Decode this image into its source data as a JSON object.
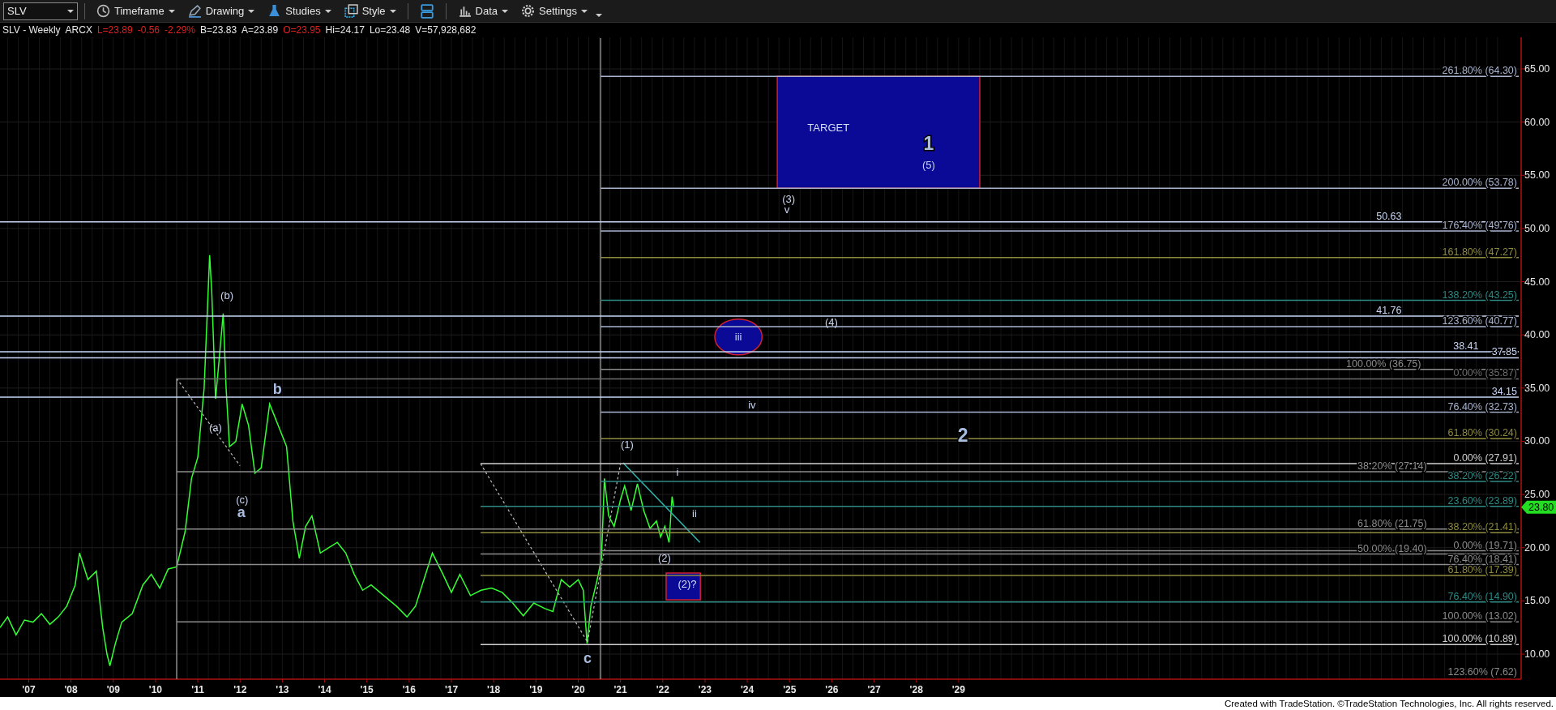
{
  "toolbar": {
    "symbol": "SLV",
    "groups": [
      [
        {
          "label": "Timeframe"
        },
        {
          "label": "Drawing"
        },
        {
          "label": "Studies"
        },
        {
          "label": "Style"
        }
      ],
      [
        {
          "label": "Data"
        },
        {
          "label": "Settings"
        }
      ]
    ]
  },
  "quote": [
    {
      "text": "SLV - Weekly",
      "color": "#e8e8e8"
    },
    {
      "text": "ARCX",
      "color": "#e8e8e8"
    },
    {
      "text": "L=23.89",
      "color": "#e02020"
    },
    {
      "text": "-0.56",
      "color": "#e02020"
    },
    {
      "text": "-2.29%",
      "color": "#e02020"
    },
    {
      "text": "B=23.83",
      "color": "#e8e8e8"
    },
    {
      "text": "A=23.89",
      "color": "#e8e8e8"
    },
    {
      "text": "O=23.95",
      "color": "#e02020"
    },
    {
      "text": "Hi=24.17",
      "color": "#e8e8e8"
    },
    {
      "text": "Lo=23.48",
      "color": "#e8e8e8"
    },
    {
      "text": "V=57,928,682",
      "color": "#e8e8e8"
    }
  ],
  "chart": {
    "chart_data": {
      "type": "line",
      "xlim": [
        2006.32,
        2042.29
      ],
      "ylim": [
        7.64,
        67.97
      ],
      "grid": true,
      "x": [
        2006.32,
        2006.5,
        2006.7,
        2006.9,
        2007.1,
        2007.3,
        2007.5,
        2007.7,
        2007.9,
        2008.1,
        2008.2,
        2008.4,
        2008.6,
        2008.75,
        2008.85,
        2008.92,
        2009.05,
        2009.2,
        2009.45,
        2009.7,
        2009.9,
        2010.1,
        2010.3,
        2010.5,
        2010.7,
        2010.85,
        2011.0,
        2011.15,
        2011.28,
        2011.33,
        2011.42,
        2011.5,
        2011.6,
        2011.67,
        2011.75,
        2011.9,
        2012.05,
        2012.2,
        2012.35,
        2012.5,
        2012.7,
        2012.8,
        2012.95,
        2013.1,
        2013.25,
        2013.4,
        2013.55,
        2013.7,
        2013.9,
        2014.1,
        2014.3,
        2014.5,
        2014.7,
        2014.9,
        2015.1,
        2015.4,
        2015.7,
        2015.95,
        2016.15,
        2016.35,
        2016.55,
        2016.8,
        2017.0,
        2017.2,
        2017.45,
        2017.7,
        2017.95,
        2018.2,
        2018.45,
        2018.7,
        2018.95,
        2019.2,
        2019.4,
        2019.6,
        2019.8,
        2020.0,
        2020.12,
        2020.21,
        2020.3,
        2020.45,
        2020.55,
        2020.62,
        2020.72,
        2020.85,
        2021.0,
        2021.1,
        2021.25,
        2021.4,
        2021.55,
        2021.7,
        2021.85,
        2021.95,
        2022.05,
        2022.15,
        2022.22,
        2022.26
      ],
      "series": [
        {
          "color": "#33ff33",
          "values": [
            12.5,
            13.5,
            11.8,
            13.2,
            13.0,
            13.8,
            12.8,
            13.5,
            14.5,
            16.5,
            19.5,
            17.0,
            17.8,
            12.5,
            10.0,
            8.9,
            11.0,
            13.0,
            13.8,
            16.5,
            17.5,
            16.2,
            18.0,
            18.2,
            21.5,
            26.5,
            28.5,
            35.0,
            47.5,
            44.0,
            34.0,
            37.5,
            42.0,
            35.0,
            29.5,
            30.0,
            33.5,
            31.5,
            27.0,
            27.5,
            33.5,
            32.5,
            31.0,
            29.5,
            22.5,
            19.0,
            22.0,
            23.0,
            19.5,
            20.0,
            20.5,
            19.5,
            17.5,
            16.0,
            16.5,
            15.5,
            14.5,
            13.5,
            14.5,
            17.0,
            19.5,
            17.5,
            15.8,
            17.5,
            15.5,
            16.0,
            16.2,
            15.8,
            14.8,
            13.6,
            14.8,
            14.3,
            14.0,
            17.0,
            16.3,
            17.0,
            16.0,
            11.0,
            14.5,
            17.0,
            19.0,
            26.5,
            23.0,
            22.0,
            24.5,
            25.8,
            23.5,
            26.0,
            23.5,
            21.8,
            22.5,
            21.0,
            22.0,
            20.5,
            24.8,
            23.8
          ]
        }
      ],
      "xticks": [
        {
          "value": 2007,
          "label": "'07"
        },
        {
          "value": 2008,
          "label": "'08"
        },
        {
          "value": 2009,
          "label": "'09"
        },
        {
          "value": 2010,
          "label": "'10"
        },
        {
          "value": 2011,
          "label": "'11"
        },
        {
          "value": 2012,
          "label": "'12"
        },
        {
          "value": 2013,
          "label": "'13"
        },
        {
          "value": 2014,
          "label": "'14"
        },
        {
          "value": 2015,
          "label": "'15"
        },
        {
          "value": 2016,
          "label": "'16"
        },
        {
          "value": 2017,
          "label": "'17"
        },
        {
          "value": 2018,
          "label": "'18"
        },
        {
          "value": 2019,
          "label": "'19"
        },
        {
          "value": 2020,
          "label": "'20"
        },
        {
          "value": 2021,
          "label": "'21"
        },
        {
          "value": 2022,
          "label": "'22"
        },
        {
          "value": 2023,
          "label": "'23"
        },
        {
          "value": 2024,
          "label": "'24"
        },
        {
          "value": 2025,
          "label": "'25"
        },
        {
          "value": 2026,
          "label": "'26"
        },
        {
          "value": 2027,
          "label": "'27"
        },
        {
          "value": 2028,
          "label": "'28"
        },
        {
          "value": 2029,
          "label": "'29"
        }
      ],
      "yticks": [
        {
          "value": 10,
          "label": "10.00"
        },
        {
          "value": 15,
          "label": "15.00"
        },
        {
          "value": 20,
          "label": "20.00"
        },
        {
          "value": 25,
          "label": "25.00"
        },
        {
          "value": 30,
          "label": "30.00"
        },
        {
          "value": 35,
          "label": "35.00"
        },
        {
          "value": 40,
          "label": "40.00"
        },
        {
          "value": 45,
          "label": "45.00"
        },
        {
          "value": 50,
          "label": "50.00"
        },
        {
          "value": 55,
          "label": "55.00"
        },
        {
          "value": 60,
          "label": "60.00"
        },
        {
          "value": 65,
          "label": "65.00"
        }
      ]
    },
    "levels": [
      {
        "label": "261.80% (64.30)",
        "color": "#a9b4cf"
      },
      {
        "label": "200.00% (53.78)",
        "color": "#a9b4cf"
      },
      {
        "label": "50.63",
        "color": "#c9d6f5"
      },
      {
        "label": "176.40% (49.76)",
        "color": "#a9b4cf"
      },
      {
        "label": "161.80% (47.27)",
        "color": "#8f8b3c"
      },
      {
        "label": "138.20% (43.25)",
        "color": "#2d8a84"
      },
      {
        "label": "41.76",
        "color": "#c9d6f5"
      },
      {
        "label": "123.60% (40.77)",
        "color": "#a9b4cf"
      },
      {
        "label": "38.41",
        "color": "#c9d6f5"
      },
      {
        "label": "37.85",
        "color": "#c9d6f5"
      },
      {
        "label": "100.00% (36.75)",
        "color": "#8c8c8c"
      },
      {
        "label": "0.00% (35.87)",
        "color": "#6e6e6e"
      },
      {
        "label": "34.15",
        "color": "#c9d6f5"
      },
      {
        "label": "76.40% (32.73)",
        "color": "#a9b4cf"
      },
      {
        "label": "61.80% (30.24)",
        "color": "#8f8b3c"
      },
      {
        "label": "0.00% (27.91)",
        "color": "#d0d0d0"
      },
      {
        "label": "38.20% (27.14)",
        "color": "#8c8c8c"
      },
      {
        "label": "38.20% (26.22)",
        "color": "#2d8a84"
      },
      {
        "label": "23.60% (23.89)",
        "color": "#2d8a84"
      },
      {
        "label": "61.80% (21.75)",
        "color": "#8c8c8c"
      },
      {
        "label": "38.20% (21.41)",
        "color": "#8f8b3c"
      },
      {
        "label": "0.00% (19.71)",
        "color": "#8c8c8c"
      },
      {
        "label": "50.00% (19.40)",
        "color": "#8c8c8c"
      },
      {
        "label": "76.40% (18.41)",
        "color": "#8c8c8c"
      },
      {
        "label": "61.80% (17.39)",
        "color": "#8f8b3c"
      },
      {
        "label": "76.40% (14.90)",
        "color": "#2d8a84"
      },
      {
        "label": "100.00% (13.02)",
        "color": "#8c8c8c"
      },
      {
        "label": "100.00% (10.89)",
        "color": "#d0d0d0"
      },
      {
        "label": "123.60% (7.62)",
        "color": "#8c8c8c"
      }
    ],
    "wave_labels": [
      {
        "text": "TARGET",
        "kind": "label"
      },
      {
        "text": "1",
        "kind": "major"
      },
      {
        "text": "(5)",
        "kind": "wave"
      },
      {
        "text": "(3)",
        "kind": "wave"
      },
      {
        "text": "v",
        "kind": "wave"
      },
      {
        "text": "iii",
        "kind": "wave"
      },
      {
        "text": "(4)",
        "kind": "wave"
      },
      {
        "text": "iv",
        "kind": "wave"
      },
      {
        "text": "2",
        "kind": "major"
      },
      {
        "text": "(1)",
        "kind": "wave"
      },
      {
        "text": "i",
        "kind": "wave"
      },
      {
        "text": "ii",
        "kind": "wave"
      },
      {
        "text": "(2)",
        "kind": "wave"
      },
      {
        "text": "(2)?",
        "kind": "label"
      },
      {
        "text": "(b)",
        "kind": "wave"
      },
      {
        "text": "(a)",
        "kind": "wave"
      },
      {
        "text": "b",
        "kind": "minor"
      },
      {
        "text": "(c)",
        "kind": "wave"
      },
      {
        "text": "a",
        "kind": "minor"
      },
      {
        "text": "c",
        "kind": "minor"
      }
    ],
    "last_price": "23.80"
  },
  "footer": "Created with TradeStation. ©TradeStation Technologies, Inc. All rights reserved."
}
